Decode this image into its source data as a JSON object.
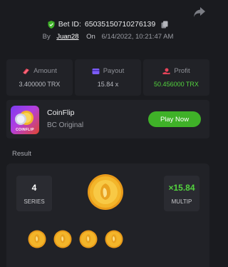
{
  "header": {
    "bet_id_label": "Bet ID:",
    "bet_id": "65035150710276139",
    "by_label": "By",
    "username": "Juan28",
    "on_label": "On",
    "datetime": "6/14/2022, 10:21:47 AM"
  },
  "stats": [
    {
      "label": "Amount",
      "value": "3.400000 TRX",
      "icon": "money-icon",
      "color": "#e8445a"
    },
    {
      "label": "Payout",
      "value": "15.84 x",
      "icon": "card-icon",
      "color": "#7b5cf6"
    },
    {
      "label": "Profit",
      "value": "50.456000 TRX",
      "icon": "hand-coin-icon",
      "color": "#e8445a",
      "value_color": "#53d33e"
    }
  ],
  "game": {
    "name": "CoinFlip",
    "subtitle": "BC Original",
    "thumb_caption": "COINFLIP",
    "play_label": "Play Now"
  },
  "result": {
    "label": "Result",
    "series_value": "4",
    "series_label": "SERIES",
    "multiplier_value": "×15.84",
    "multiplier_label": "MULTIP",
    "coin_count": 4
  },
  "colors": {
    "background": "#1a1b1f",
    "panel": "#212227",
    "accent_green": "#3fb128",
    "profit_green": "#53d33e",
    "coin_gold": "#f3b52a"
  }
}
